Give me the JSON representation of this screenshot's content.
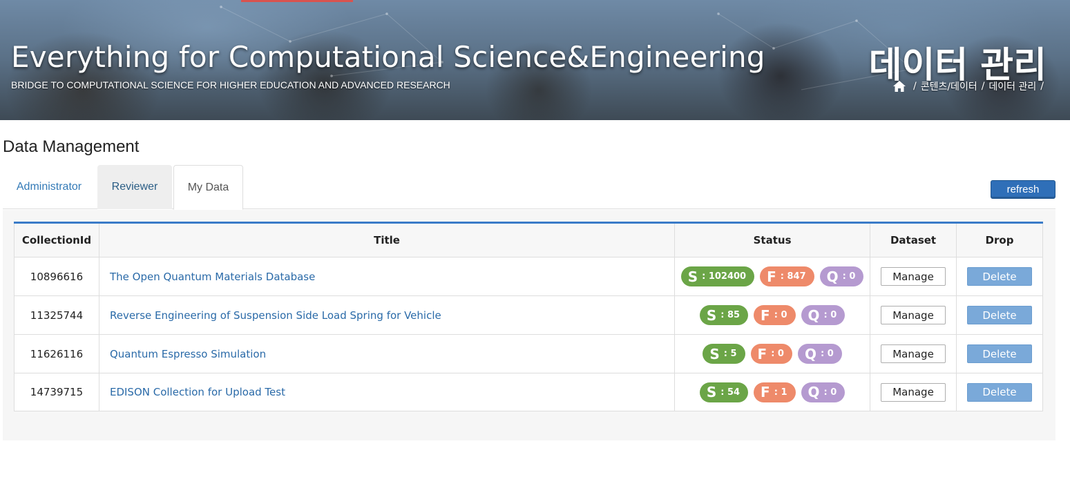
{
  "banner": {
    "title": "Everything for Computational Science&Engineering",
    "subtitle": "BRIDGE TO COMPUTATIONAL SCIENCE FOR HIGHER EDUCATION AND ADVANCED RESEARCH",
    "page_heading": "데이터 관리",
    "breadcrumb": {
      "home_icon": "home-icon",
      "separator": "/",
      "items": [
        "콘텐츠/데이터",
        "데이터 관리"
      ]
    },
    "accent_color": "#d9534f"
  },
  "section": {
    "title": "Data Management"
  },
  "tabs": [
    {
      "label": "Administrator",
      "active": false
    },
    {
      "label": "Reviewer",
      "active": false
    },
    {
      "label": "My Data",
      "active": true
    }
  ],
  "toolbar": {
    "refresh_label": "refresh"
  },
  "table": {
    "columns": [
      "CollectionId",
      "Title",
      "Status",
      "Dataset",
      "Drop"
    ],
    "rows": [
      {
        "id": "10896616",
        "title": "The Open Quantum Materials Database",
        "s": "S",
        "s_val": ": 102400",
        "f": "F",
        "f_val": ": 847",
        "q": "Q",
        "q_val": ": 0",
        "manage": "Manage",
        "delete": "Delete"
      },
      {
        "id": "11325744",
        "title": "Reverse Engineering of Suspension Side Load Spring for Vehicle",
        "s": "S",
        "s_val": ": 85",
        "f": "F",
        "f_val": ": 0",
        "q": "Q",
        "q_val": ": 0",
        "manage": "Manage",
        "delete": "Delete"
      },
      {
        "id": "11626116",
        "title": "Quantum Espresso Simulation",
        "s": "S",
        "s_val": ": 5",
        "f": "F",
        "f_val": ": 0",
        "q": "Q",
        "q_val": ": 0",
        "manage": "Manage",
        "delete": "Delete"
      },
      {
        "id": "14739715",
        "title": "EDISON Collection for Upload Test",
        "s": "S",
        "s_val": ": 54",
        "f": "F",
        "f_val": ": 1",
        "q": "Q",
        "q_val": ": 0",
        "manage": "Manage",
        "delete": "Delete"
      }
    ]
  },
  "colors": {
    "success": "#6ba547",
    "fail": "#ee8a6a",
    "queue": "#b59ad0",
    "link": "#2a6aa8",
    "primary": "#2f6fb8"
  }
}
